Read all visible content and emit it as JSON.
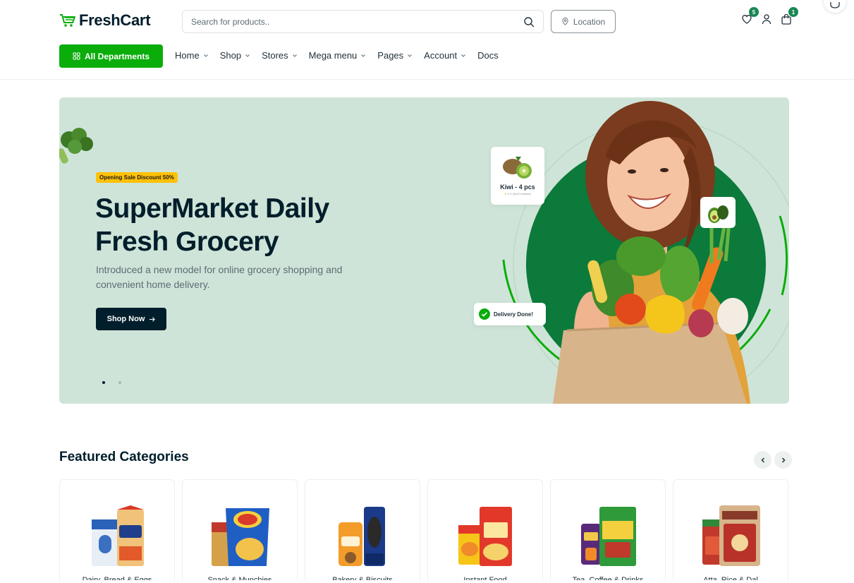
{
  "header": {
    "logo_text": "FreshCart",
    "search_placeholder": "Search for products..",
    "location_label": "Location",
    "wishlist_count": "5",
    "cart_count": "1"
  },
  "nav": {
    "departments_label": "All Departments",
    "items": [
      {
        "label": "Home",
        "has_dropdown": true
      },
      {
        "label": "Shop",
        "has_dropdown": true
      },
      {
        "label": "Stores",
        "has_dropdown": true
      },
      {
        "label": "Mega menu",
        "has_dropdown": true
      },
      {
        "label": "Pages",
        "has_dropdown": true
      },
      {
        "label": "Account",
        "has_dropdown": true
      },
      {
        "label": "Docs",
        "has_dropdown": false
      }
    ]
  },
  "hero": {
    "badge": "Opening Sale Discount 50%",
    "title": "SuperMarket Daily Fresh Grocery",
    "description": "Introduced a new model for online grocery shopping and convenient home delivery.",
    "button_label": "Shop Now",
    "kiwi_card": {
      "name": "Kiwi - 4 pcs",
      "rating": "4.9",
      "reviews": "(3400 reviews)"
    },
    "delivery_label": "Delivery Done!",
    "slide_count": 2,
    "active_slide": 1
  },
  "featured": {
    "title": "Featured Categories",
    "categories": [
      {
        "label": "Dairy, Bread & Eggs"
      },
      {
        "label": "Snack & Munchies"
      },
      {
        "label": "Bakery & Biscuits"
      },
      {
        "label": "Instant Food"
      },
      {
        "label": "Tea, Coffee & Drinks"
      },
      {
        "label": "Atta, Rice & Dal"
      }
    ]
  },
  "colors": {
    "brand_green": "#0aad0a",
    "dark": "#001e2b",
    "hero_bg": "#cfe4d8",
    "sale_badge": "#ffc107"
  }
}
